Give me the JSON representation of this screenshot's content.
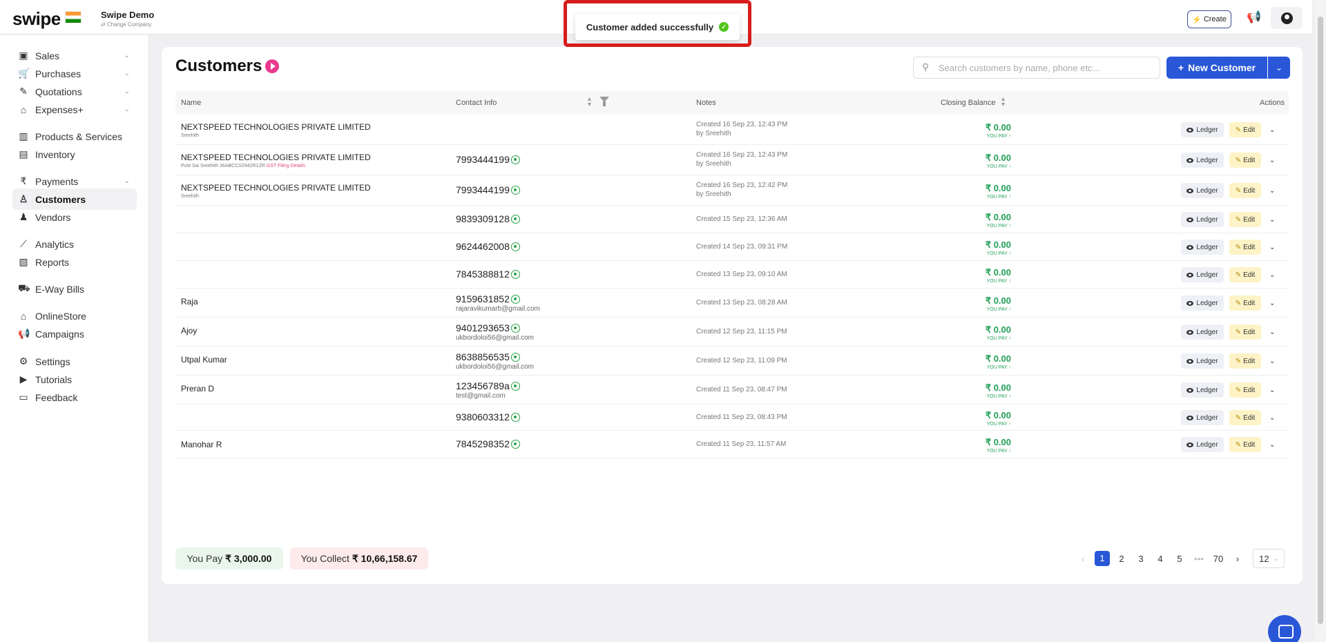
{
  "header": {
    "logo_text": "swipe",
    "company_name": "Swipe Demo",
    "change_company": "⇄ Change Company",
    "create_label": "Create",
    "icons": [
      "flag-india-icon",
      "bolt-icon",
      "megaphone-icon",
      "user-icon"
    ]
  },
  "toast": {
    "message": "Customer added successfully",
    "highlight_color": "#d71c1c",
    "success_color": "#52c41a"
  },
  "sidebar": {
    "items": [
      {
        "label": "Sales",
        "icon": "sales-icon",
        "expandable": true
      },
      {
        "label": "Purchases",
        "icon": "cart-icon",
        "expandable": true
      },
      {
        "label": "Quotations",
        "icon": "pen-icon",
        "expandable": true
      },
      {
        "label": "Expenses+",
        "icon": "tag-icon",
        "expandable": true
      },
      {
        "label": "Products & Services",
        "icon": "barcode-icon",
        "expandable": false
      },
      {
        "label": "Inventory",
        "icon": "inventory-icon",
        "expandable": false
      },
      {
        "label": "Payments",
        "icon": "rupee-icon",
        "expandable": true
      },
      {
        "label": "Customers",
        "icon": "user-icon",
        "expandable": false,
        "active": true
      },
      {
        "label": "Vendors",
        "icon": "users-icon",
        "expandable": false
      },
      {
        "label": "Analytics",
        "icon": "chart-icon",
        "expandable": false
      },
      {
        "label": "Reports",
        "icon": "report-icon",
        "expandable": false
      },
      {
        "label": "E-Way Bills",
        "icon": "truck-icon",
        "expandable": false
      },
      {
        "label": "OnlineStore",
        "icon": "store-icon",
        "expandable": false
      },
      {
        "label": "Campaigns",
        "icon": "megaphone-icon",
        "expandable": false
      },
      {
        "label": "Settings",
        "icon": "gear-icon",
        "expandable": false
      },
      {
        "label": "Tutorials",
        "icon": "youtube-icon",
        "expandable": false
      },
      {
        "label": "Feedback",
        "icon": "message-icon",
        "expandable": false
      }
    ]
  },
  "main": {
    "title": "Customers",
    "search_placeholder": "Search customers by name, phone etc...",
    "new_button": "New Customer",
    "columns": {
      "name": "Name",
      "contact": "Contact Info",
      "notes": "Notes",
      "balance": "Closing Balance",
      "actions": "Actions"
    },
    "action_labels": {
      "ledger": "Ledger",
      "edit": "Edit"
    },
    "rows": [
      {
        "name": "NEXTSPEED TECHNOLOGIES PRIVATE LIMITED",
        "sub": "Sreehith",
        "sub_extra": "",
        "phone": "",
        "email": "",
        "notes": "Created 16 Sep 23, 12:43 PM",
        "notes_by": "by Sreehith",
        "balance": "₹ 0.00",
        "balance_tag": "YOU PAY"
      },
      {
        "name": "NEXTSPEED TECHNOLOGIES PRIVATE LIMITED",
        "sub": "Putti Sai Sreehith 36ABCCS2942R1ZR",
        "sub_extra": "GST Filing Details",
        "phone": "7993444199",
        "email": "",
        "notes": "Created 16 Sep 23, 12:43 PM",
        "notes_by": "by Sreehith",
        "balance": "₹ 0.00",
        "balance_tag": "YOU PAY"
      },
      {
        "name": "NEXTSPEED TECHNOLOGIES PRIVATE LIMITED",
        "sub": "Sreehith",
        "sub_extra": "",
        "phone": "7993444199",
        "email": "",
        "notes": "Created 16 Sep 23, 12:42 PM",
        "notes_by": "by Sreehith",
        "balance": "₹ 0.00",
        "balance_tag": "YOU PAY"
      },
      {
        "name": "",
        "sub": "",
        "sub_extra": "",
        "phone": "9839309128",
        "email": "",
        "notes": "Created 15 Sep 23, 12:36 AM",
        "notes_by": "",
        "balance": "₹ 0.00",
        "balance_tag": "YOU PAY"
      },
      {
        "name": "",
        "sub": "",
        "sub_extra": "",
        "phone": "9624462008",
        "email": "",
        "notes": "Created 14 Sep 23, 09:31 PM",
        "notes_by": "",
        "balance": "₹ 0.00",
        "balance_tag": "YOU PAY"
      },
      {
        "name": "",
        "sub": "",
        "sub_extra": "",
        "phone": "7845388812",
        "email": "",
        "notes": "Created 13 Sep 23, 09:10 AM",
        "notes_by": "",
        "balance": "₹ 0.00",
        "balance_tag": "YOU PAY"
      },
      {
        "name": "Raja",
        "sub": "",
        "sub_extra": "",
        "phone": "9159631852",
        "email": "rajaravikumarb@gmail.com",
        "notes": "Created 13 Sep 23, 08:28 AM",
        "notes_by": "",
        "balance": "₹ 0.00",
        "balance_tag": "YOU PAY"
      },
      {
        "name": "Ajoy",
        "sub": "",
        "sub_extra": "",
        "phone": "9401293653",
        "email": "ukbordoloi56@gmail.com",
        "notes": "Created 12 Sep 23, 11:15 PM",
        "notes_by": "",
        "balance": "₹ 0.00",
        "balance_tag": "YOU PAY"
      },
      {
        "name": "Utpal Kumar",
        "sub": "",
        "sub_extra": "",
        "phone": "8638856535",
        "email": "ukbordoloi56@gmail.com",
        "notes": "Created 12 Sep 23, 11:09 PM",
        "notes_by": "",
        "balance": "₹ 0.00",
        "balance_tag": "YOU PAY"
      },
      {
        "name": "Preran D",
        "sub": "",
        "sub_extra": "",
        "phone": "123456789a",
        "email": "test@gmail.com",
        "notes": "Created 11 Sep 23, 08:47 PM",
        "notes_by": "",
        "balance": "₹ 0.00",
        "balance_tag": "YOU PAY"
      },
      {
        "name": "",
        "sub": "",
        "sub_extra": "",
        "phone": "9380603312",
        "email": "",
        "notes": "Created 11 Sep 23, 08:43 PM",
        "notes_by": "",
        "balance": "₹ 0.00",
        "balance_tag": "YOU PAY"
      },
      {
        "name": "Manohar R",
        "sub": "",
        "sub_extra": "",
        "phone": "7845298352",
        "email": "",
        "notes": "Created 11 Sep 23, 11:57 AM",
        "notes_by": "",
        "balance": "₹ 0.00",
        "balance_tag": "YOU PAY"
      }
    ],
    "summary": {
      "pay_label": "You Pay",
      "pay_amount": "₹ 3,000.00",
      "collect_label": "You Collect",
      "collect_amount": "₹ 10,66,158.67"
    },
    "pagination": {
      "prev": "‹",
      "pages": [
        "1",
        "2",
        "3",
        "4",
        "5"
      ],
      "current": "1",
      "ellipsis": "•••",
      "last": "70",
      "next": "›",
      "per_page": "12"
    }
  },
  "colors": {
    "brand_blue": "#2957d8",
    "positive_green": "#22a057",
    "play_pink": "#e8398f"
  }
}
